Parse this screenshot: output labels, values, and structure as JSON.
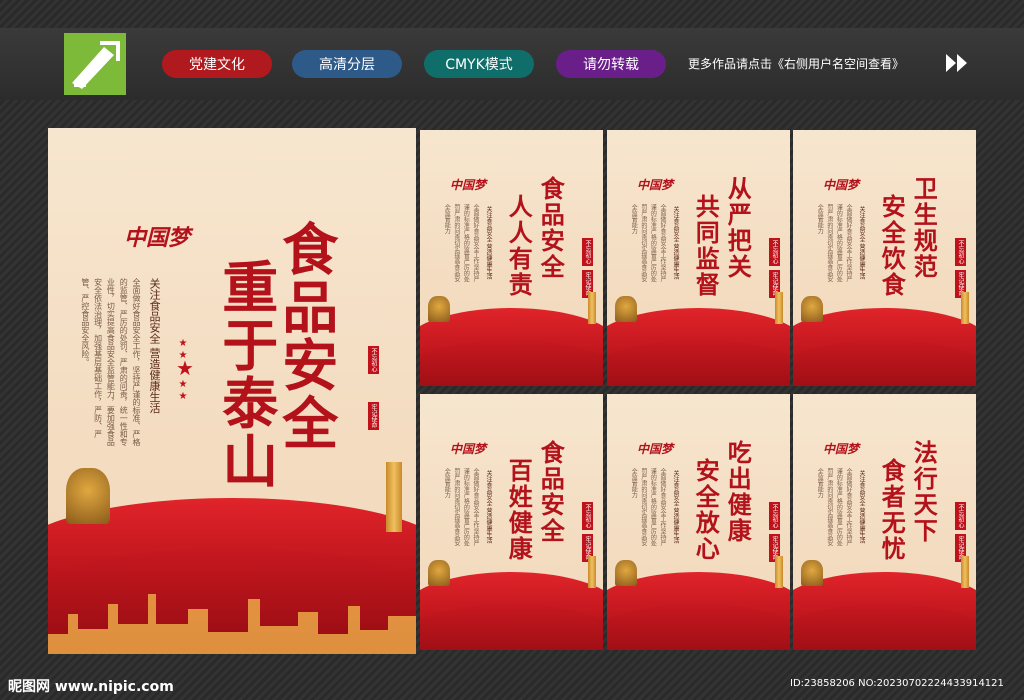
{
  "header": {
    "tags": [
      {
        "label": "党建文化",
        "color": "#b01a1e"
      },
      {
        "label": "高清分层",
        "color": "#2e5a8a"
      },
      {
        "label": "CMYK模式",
        "color": "#0f6e6a"
      },
      {
        "label": "请勿转载",
        "color": "#6a1e8a"
      }
    ],
    "more_text": "更多作品请点击《右侧用户名空间查看》"
  },
  "main_poster": {
    "logo_text": "中国梦",
    "title": "食品安全重于泰山",
    "title_col1": "食品安全",
    "title_col2": "重于泰山",
    "subtitle": "关注食品安全 营造健康生活",
    "body": "全面做好食品安全工作，坚持严谨的标准、严格的监管、严厉的处罚、严肃的问责，统一性和专业性，切实提高食品安全监管能力，要加强食品安全依法治理，加强基层基础工作，严防、严管、严控食品安全风险。",
    "seal1": "不忘初心",
    "seal2": "牢记使命"
  },
  "posters": [
    {
      "title_col1": "食品安全",
      "title_col2": "人人有责"
    },
    {
      "title_col1": "从严把关",
      "title_col2": "共同监督"
    },
    {
      "title_col1": "卫生规范",
      "title_col2": "安全饮食"
    },
    {
      "title_col1": "食品安全",
      "title_col2": "百姓健康"
    },
    {
      "title_col1": "吃出健康",
      "title_col2": "安全放心"
    },
    {
      "title_col1": "法行天下",
      "title_col2": "食者无忧"
    }
  ],
  "small_subtitle": "关注食品安全 营造健康生活",
  "small_body": "全面做好食品安全工作坚持严谨的标准严格的监管严厉的处罚严肃的问责切实提高食品安全监管能力",
  "small_seal1": "不忘初心",
  "small_seal2": "牢记使命",
  "footer": {
    "site": "昵图网 www.nipic.com",
    "id_text": "ID:23858206 NO:20230702224433914121"
  }
}
